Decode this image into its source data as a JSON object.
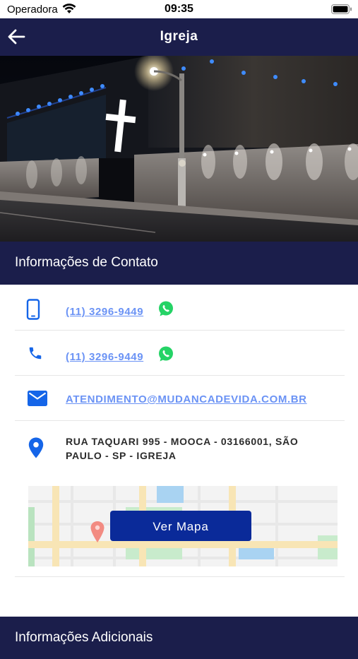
{
  "status": {
    "carrier": "Operadora",
    "time": "09:35"
  },
  "nav": {
    "title": "Igreja",
    "back_icon": "arrow-left-icon"
  },
  "contact_section": {
    "title": "Informações de Contato"
  },
  "contacts": {
    "mobile": {
      "icon": "smartphone-icon",
      "value": "(11) 3296-9449",
      "whatsapp_icon": "whatsapp-icon"
    },
    "phone": {
      "icon": "phone-icon",
      "value": "(11) 3296-9449",
      "whatsapp_icon": "whatsapp-icon"
    },
    "email": {
      "icon": "mail-icon",
      "value": "ATENDIMENTO@MUDANCADEVIDA.COM.BR"
    },
    "address": {
      "icon": "map-pin-icon",
      "value": "RUA TAQUARI 995 - MOOCA - 03166001, SÃO PAULO - SP - IGREJA"
    }
  },
  "map": {
    "button_label": "Ver Mapa"
  },
  "additional_section": {
    "title": "Informações Adicionais"
  },
  "colors": {
    "nav_bg": "#1b1e4b",
    "accent_blue": "#1565e8",
    "link": "#6b93f5",
    "whatsapp": "#25d366",
    "map_button": "#0a2a99"
  }
}
